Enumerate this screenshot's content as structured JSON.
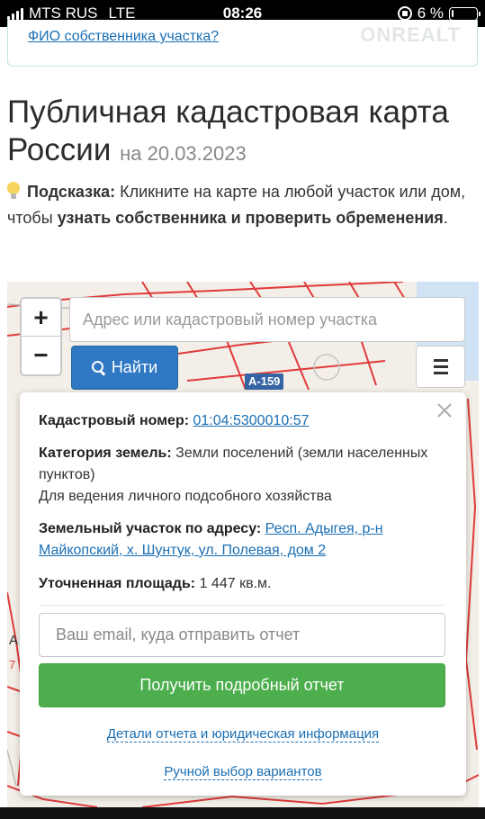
{
  "status_bar": {
    "carrier": "MTS RUS",
    "network": "LTE",
    "time": "08:26",
    "battery_text": "6 %",
    "battery_level": 0.06
  },
  "top_box": {
    "link": "ФИО собственника участка?",
    "watermark": "ONREALT"
  },
  "page": {
    "title": "Публичная кадастровая карта России",
    "title_date": "на 20.03.2023",
    "hint_label": "Подсказка:",
    "hint_text_1": "Кликните на карте на любой участок или дом, чтобы",
    "hint_bold": "узнать собственника и проверить обременения",
    "hint_end": "."
  },
  "map": {
    "zoom_in": "+",
    "zoom_out": "−",
    "search_placeholder": "Адрес или кадастровый номер участка",
    "find_button": "Найти",
    "road_label": "А-159",
    "edge_letter": "А",
    "edge_number": "7"
  },
  "popup": {
    "cadastral_label": "Кадастровый номер:",
    "cadastral_value": "01:04:5300010:57",
    "category_label": "Категория земель:",
    "category_value": "Земли поселений (земли населенных пунктов)",
    "usage": "Для ведения личного подсобного хозяйства",
    "address_label": "Земельный участок по адресу:",
    "address_value": "Респ. Адыгея, р-н Майкопский, х. Шунтук, ул. Полевая, дом 2",
    "area_label": "Уточненная площадь:",
    "area_value": "1 447 кв.м.",
    "email_placeholder": "Ваш email, куда отправить отчет",
    "report_button": "Получить подробный отчет",
    "details_link": "Детали отчета и юридическая информация",
    "manual_link": "Ручной выбор вариантов"
  },
  "colors": {
    "link": "#1a6fb4",
    "find_button": "#2f78c4",
    "report_button": "#4cae4c",
    "parcel_lines": "#e03a3a"
  }
}
